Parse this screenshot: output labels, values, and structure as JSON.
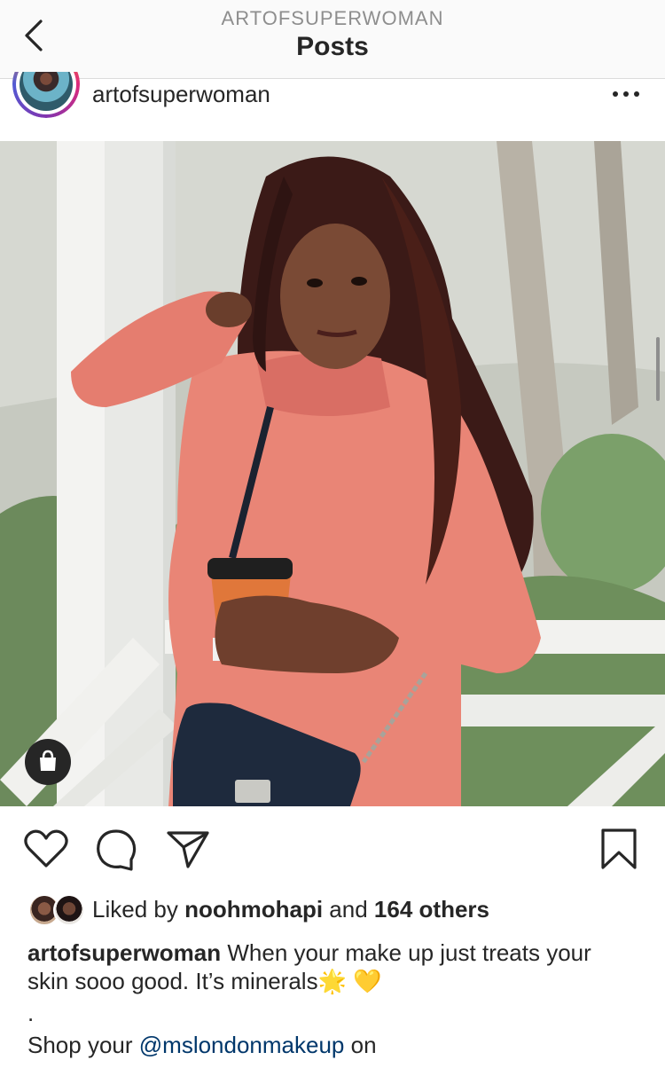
{
  "header": {
    "account_name": "ARTOFSUPERWOMAN",
    "title": "Posts",
    "back_icon": "chevron-left-icon"
  },
  "post": {
    "username": "artofsuperwoman",
    "more_icon": "more-horizontal-icon",
    "shop_icon": "shopping-bag-icon"
  },
  "actions": {
    "like_icon": "heart-icon",
    "comment_icon": "comment-icon",
    "share_icon": "send-icon",
    "save_icon": "bookmark-icon"
  },
  "likes": {
    "prefix": "Liked by",
    "user": "noohmohapi",
    "conjunction": "and",
    "others": "164 others"
  },
  "caption": {
    "username": "artofsuperwoman",
    "text": "When your make up just treats your skin sooo good. It’s minerals",
    "emoji": "🌟 💛",
    "dot": ".",
    "shop_prefix": "Shop your",
    "mention": "@mslondonmakeup",
    "shop_suffix": "on"
  },
  "colors": {
    "text": "#262626",
    "secondary": "#8e8e8e",
    "mention": "#00376b",
    "divider": "#dbdbdb"
  }
}
